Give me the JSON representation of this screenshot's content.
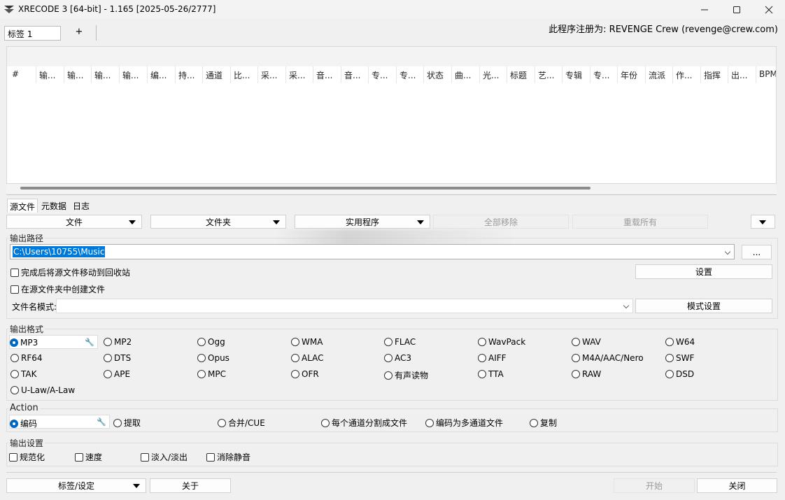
{
  "window": {
    "title": "XRECODE 3 [64-bit] - 1.165 [2025-05-26/2777]",
    "minimize_icon": "minimize-icon",
    "maximize_icon": "maximize-icon",
    "close_icon": "close-icon"
  },
  "tabs": {
    "tab1": "标签 1",
    "add": "+"
  },
  "registration": "此程序注册为: REVENGE Crew (revenge@crew.com)",
  "columns": [
    "#",
    "输...",
    "输...",
    "输...",
    "输...",
    "编...",
    "持...",
    "通道",
    "比...",
    "采...",
    "采...",
    "音...",
    "音...",
    "专...",
    "专...",
    "状态",
    "曲...",
    "光...",
    "标题",
    "艺...",
    "专辑",
    "专...",
    "年份",
    "流派",
    "作...",
    "指挥",
    "出...",
    "BPM"
  ],
  "subtabs": [
    "源文件",
    "元数据",
    "日志"
  ],
  "toolbar": {
    "file": "文件",
    "folder": "文件夹",
    "utilities": "实用程序",
    "remove_all": "全部移除",
    "reload_all": "重载所有"
  },
  "output_path": {
    "label": "输出路径",
    "value": "C:\\Users\\10755\\Music",
    "browse": "...",
    "move_to_recycle": "完成后将源文件移动到回收站",
    "create_in_source": "在源文件夹中创建文件",
    "settings": "设置",
    "filename_pattern_label": "文件名模式:",
    "filename_pattern_value": "",
    "pattern_settings": "模式设置"
  },
  "output_format": {
    "label": "输出格式",
    "selected": "MP3",
    "options": [
      "MP2",
      "Ogg",
      "WMA",
      "FLAC",
      "WavPack",
      "WAV",
      "W64",
      "RF64",
      "DTS",
      "Opus",
      "ALAC",
      "AC3",
      "AIFF",
      "M4A/AAC/Nero",
      "SWF",
      "TAK",
      "APE",
      "MPC",
      "OFR",
      "有声读物",
      "TTA",
      "RAW",
      "DSD",
      "U-Law/A-Law"
    ]
  },
  "action": {
    "label": "Action",
    "selected": "编码",
    "options": [
      "提取",
      "合并/CUE",
      "每个通道分割成文件",
      "编码为多通道文件",
      "复制"
    ]
  },
  "output_settings": {
    "label": "输出设置",
    "options": [
      "规范化",
      "速度",
      "淡入/淡出",
      "消除静音"
    ]
  },
  "bottom": {
    "tags_settings": "标签/设定",
    "about": "关于",
    "start": "开始",
    "close": "关闭"
  }
}
